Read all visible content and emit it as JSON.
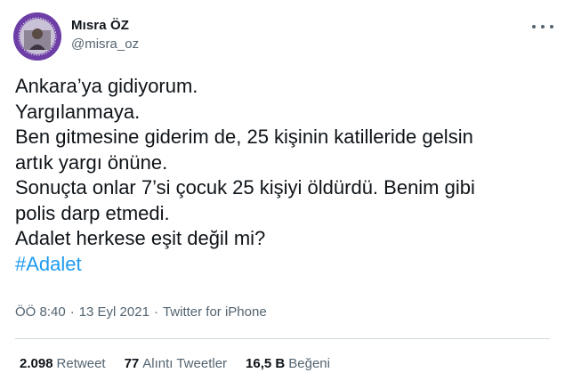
{
  "author": {
    "display_name": "Mısra ÖZ",
    "handle": "@misra_oz",
    "avatar_color": "#6d3fa6"
  },
  "tweet": {
    "lines": [
      "Ankara’ya gidiyorum.",
      "Yargılanmaya.",
      "Ben gitmesine giderim de, 25 kişinin katilleride gelsin",
      "artık yargı önüne.",
      "Sonuçta onlar 7’si çocuk 25 kişiyi öldürdü. Benim gibi",
      "polis darp etmedi.",
      "Adalet herkese eşit değil mi?"
    ],
    "hashtag": "#Adalet",
    "hashtag_color": "#1d9bf0"
  },
  "meta": {
    "time": "ÖÖ 8:40",
    "separator": "·",
    "date": "13 Eyl 2021",
    "source": "Twitter for iPhone"
  },
  "stats": {
    "retweets_count": "2.098",
    "retweets_label": "Retweet",
    "quotes_count": "77",
    "quotes_label": "Alıntı Tweetler",
    "likes_count": "16,5 B",
    "likes_label": "Beğeni"
  },
  "icons": {
    "more": "more-horizontal-icon"
  }
}
